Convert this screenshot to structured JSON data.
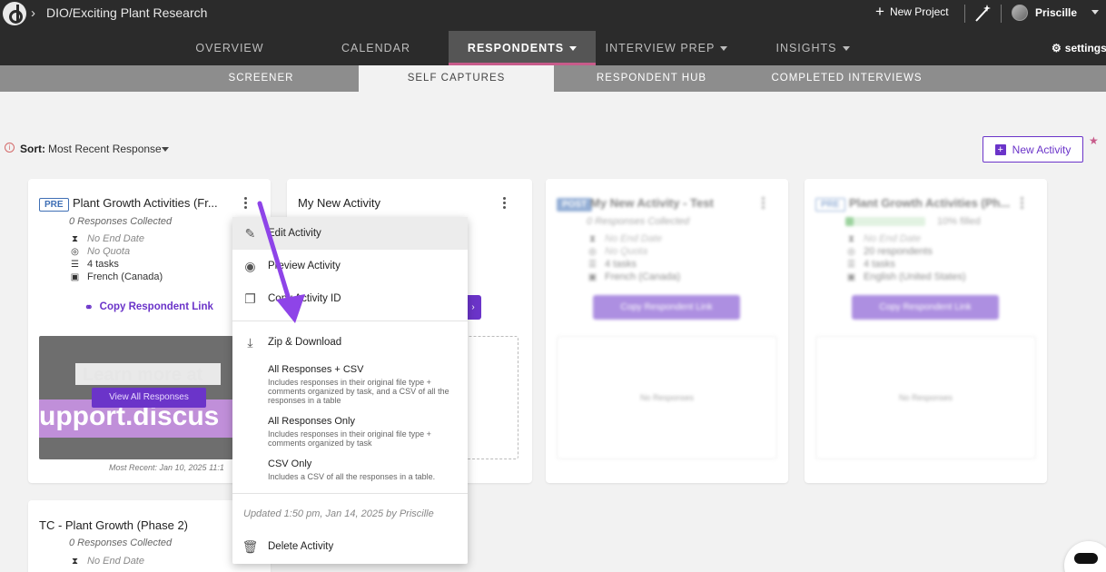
{
  "topbar": {
    "breadcrumb": "DIO/Exciting Plant Research",
    "new_project": "New Project",
    "user_name": "Priscille"
  },
  "nav": {
    "tabs": [
      {
        "label": "OVERVIEW",
        "active": false,
        "dropdown": false
      },
      {
        "label": "CALENDAR",
        "active": false,
        "dropdown": false
      },
      {
        "label": "RESPONDENTS",
        "active": true,
        "dropdown": true
      },
      {
        "label": "INTERVIEW PREP",
        "active": false,
        "dropdown": true
      },
      {
        "label": "INSIGHTS",
        "active": false,
        "dropdown": true
      }
    ],
    "settings": "settings"
  },
  "subnav": {
    "tabs": [
      {
        "label": "SCREENER",
        "active": false
      },
      {
        "label": "SELF CAPTURES",
        "active": true
      },
      {
        "label": "RESPONDENT HUB",
        "active": false
      },
      {
        "label": "COMPLETED INTERVIEWS",
        "active": false
      }
    ]
  },
  "sort": {
    "label": "Sort:",
    "value": "Most Recent Response",
    "new_activity": "New Activity"
  },
  "cards": [
    {
      "badge": "PRE",
      "title": "Plant Growth Activities (Fr...",
      "responses": "0 Responses Collected",
      "end_date": "No End Date",
      "quota": "No Quota",
      "tasks": "4 tasks",
      "language": "French (Canada)",
      "copy_link": "Copy Respondent Link",
      "thumb_text": "upport.discus",
      "thumb_text_top": "Learn more at",
      "view_all": "View All Responses",
      "most_recent": "Most Recent: Jan 10, 2025 11:1"
    },
    {
      "title": "My New Activity"
    },
    {
      "badge": "POST",
      "title": "My New Activity - Test",
      "responses": "0 Responses Collected",
      "end_date": "No End Date",
      "quota": "No Quota",
      "tasks": "4 tasks",
      "language": "French (Canada)",
      "copy_link": "Copy Respondent Link",
      "no_responses": "No Responses"
    },
    {
      "badge": "PRE",
      "title": "Plant Growth Activities (Ph...",
      "filled": "10% filled",
      "filled_fraction": 0.1,
      "end_date": "No End Date",
      "respondents": "20 respondents",
      "tasks": "4 tasks",
      "language": "English (United States)",
      "copy_link": "Copy Respondent Link",
      "no_responses": "No Responses"
    },
    {
      "title": "TC - Plant Growth (Phase 2)",
      "responses": "0 Responses Collected",
      "end_date": "No End Date"
    }
  ],
  "menu": {
    "edit": "Edit Activity",
    "preview": "Preview Activity",
    "copy_id": "Copy Activity ID",
    "zip": "Zip & Download",
    "options": [
      {
        "title": "All Responses + CSV",
        "desc": "Includes responses in their original file type + comments organized by task, and a CSV of all the responses in a table"
      },
      {
        "title": "All Responses Only",
        "desc": "Includes responses in their original file type + comments organized by task"
      },
      {
        "title": "CSV Only",
        "desc": "Includes a CSV of all the responses in a table."
      }
    ],
    "updated": "Updated 1:50 pm, Jan 14, 2025 by Priscille",
    "delete": "Delete Activity"
  },
  "colors": {
    "accent": "#6b34c9",
    "active_tab_underline": "#c75b8a",
    "badge": "#3f6fb5",
    "annotation_arrow": "#8e44e8"
  }
}
